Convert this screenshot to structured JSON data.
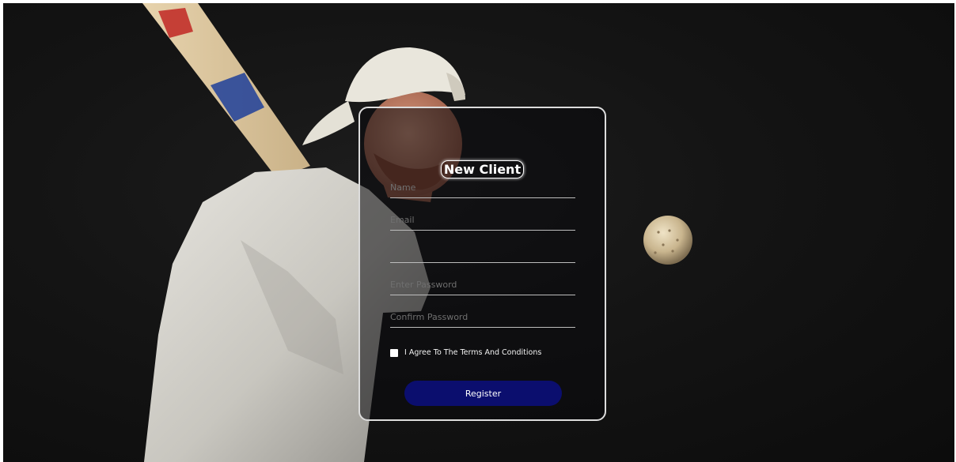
{
  "form": {
    "title": "New Client",
    "fields": {
      "name": {
        "placeholder": "Name"
      },
      "email": {
        "placeholder": "Email"
      },
      "phone": {
        "placeholder": ""
      },
      "password": {
        "placeholder": "Enter Password"
      },
      "confirm": {
        "placeholder": "Confirm Password"
      }
    },
    "terms_label": "I Agree To The Terms And Conditions",
    "terms_checked": false,
    "submit_label": "Register"
  },
  "colors": {
    "background": "#131313",
    "card_border": "#dcdcdc",
    "button": "#0b0e6e",
    "text": "#ffffff"
  }
}
